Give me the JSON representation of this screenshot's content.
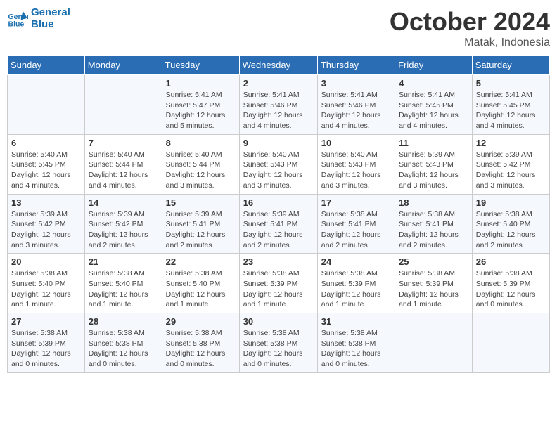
{
  "header": {
    "logo": "GeneralBlue",
    "title": "October 2024",
    "subtitle": "Matak, Indonesia"
  },
  "days_of_week": [
    "Sunday",
    "Monday",
    "Tuesday",
    "Wednesday",
    "Thursday",
    "Friday",
    "Saturday"
  ],
  "weeks": [
    [
      {
        "day": "",
        "detail": ""
      },
      {
        "day": "",
        "detail": ""
      },
      {
        "day": "1",
        "detail": "Sunrise: 5:41 AM\nSunset: 5:47 PM\nDaylight: 12 hours\nand 5 minutes."
      },
      {
        "day": "2",
        "detail": "Sunrise: 5:41 AM\nSunset: 5:46 PM\nDaylight: 12 hours\nand 4 minutes."
      },
      {
        "day": "3",
        "detail": "Sunrise: 5:41 AM\nSunset: 5:46 PM\nDaylight: 12 hours\nand 4 minutes."
      },
      {
        "day": "4",
        "detail": "Sunrise: 5:41 AM\nSunset: 5:45 PM\nDaylight: 12 hours\nand 4 minutes."
      },
      {
        "day": "5",
        "detail": "Sunrise: 5:41 AM\nSunset: 5:45 PM\nDaylight: 12 hours\nand 4 minutes."
      }
    ],
    [
      {
        "day": "6",
        "detail": "Sunrise: 5:40 AM\nSunset: 5:45 PM\nDaylight: 12 hours\nand 4 minutes."
      },
      {
        "day": "7",
        "detail": "Sunrise: 5:40 AM\nSunset: 5:44 PM\nDaylight: 12 hours\nand 4 minutes."
      },
      {
        "day": "8",
        "detail": "Sunrise: 5:40 AM\nSunset: 5:44 PM\nDaylight: 12 hours\nand 3 minutes."
      },
      {
        "day": "9",
        "detail": "Sunrise: 5:40 AM\nSunset: 5:43 PM\nDaylight: 12 hours\nand 3 minutes."
      },
      {
        "day": "10",
        "detail": "Sunrise: 5:40 AM\nSunset: 5:43 PM\nDaylight: 12 hours\nand 3 minutes."
      },
      {
        "day": "11",
        "detail": "Sunrise: 5:39 AM\nSunset: 5:43 PM\nDaylight: 12 hours\nand 3 minutes."
      },
      {
        "day": "12",
        "detail": "Sunrise: 5:39 AM\nSunset: 5:42 PM\nDaylight: 12 hours\nand 3 minutes."
      }
    ],
    [
      {
        "day": "13",
        "detail": "Sunrise: 5:39 AM\nSunset: 5:42 PM\nDaylight: 12 hours\nand 3 minutes."
      },
      {
        "day": "14",
        "detail": "Sunrise: 5:39 AM\nSunset: 5:42 PM\nDaylight: 12 hours\nand 2 minutes."
      },
      {
        "day": "15",
        "detail": "Sunrise: 5:39 AM\nSunset: 5:41 PM\nDaylight: 12 hours\nand 2 minutes."
      },
      {
        "day": "16",
        "detail": "Sunrise: 5:39 AM\nSunset: 5:41 PM\nDaylight: 12 hours\nand 2 minutes."
      },
      {
        "day": "17",
        "detail": "Sunrise: 5:38 AM\nSunset: 5:41 PM\nDaylight: 12 hours\nand 2 minutes."
      },
      {
        "day": "18",
        "detail": "Sunrise: 5:38 AM\nSunset: 5:41 PM\nDaylight: 12 hours\nand 2 minutes."
      },
      {
        "day": "19",
        "detail": "Sunrise: 5:38 AM\nSunset: 5:40 PM\nDaylight: 12 hours\nand 2 minutes."
      }
    ],
    [
      {
        "day": "20",
        "detail": "Sunrise: 5:38 AM\nSunset: 5:40 PM\nDaylight: 12 hours\nand 1 minute."
      },
      {
        "day": "21",
        "detail": "Sunrise: 5:38 AM\nSunset: 5:40 PM\nDaylight: 12 hours\nand 1 minute."
      },
      {
        "day": "22",
        "detail": "Sunrise: 5:38 AM\nSunset: 5:40 PM\nDaylight: 12 hours\nand 1 minute."
      },
      {
        "day": "23",
        "detail": "Sunrise: 5:38 AM\nSunset: 5:39 PM\nDaylight: 12 hours\nand 1 minute."
      },
      {
        "day": "24",
        "detail": "Sunrise: 5:38 AM\nSunset: 5:39 PM\nDaylight: 12 hours\nand 1 minute."
      },
      {
        "day": "25",
        "detail": "Sunrise: 5:38 AM\nSunset: 5:39 PM\nDaylight: 12 hours\nand 1 minute."
      },
      {
        "day": "26",
        "detail": "Sunrise: 5:38 AM\nSunset: 5:39 PM\nDaylight: 12 hours\nand 0 minutes."
      }
    ],
    [
      {
        "day": "27",
        "detail": "Sunrise: 5:38 AM\nSunset: 5:39 PM\nDaylight: 12 hours\nand 0 minutes."
      },
      {
        "day": "28",
        "detail": "Sunrise: 5:38 AM\nSunset: 5:38 PM\nDaylight: 12 hours\nand 0 minutes."
      },
      {
        "day": "29",
        "detail": "Sunrise: 5:38 AM\nSunset: 5:38 PM\nDaylight: 12 hours\nand 0 minutes."
      },
      {
        "day": "30",
        "detail": "Sunrise: 5:38 AM\nSunset: 5:38 PM\nDaylight: 12 hours\nand 0 minutes."
      },
      {
        "day": "31",
        "detail": "Sunrise: 5:38 AM\nSunset: 5:38 PM\nDaylight: 12 hours\nand 0 minutes."
      },
      {
        "day": "",
        "detail": ""
      },
      {
        "day": "",
        "detail": ""
      }
    ]
  ]
}
